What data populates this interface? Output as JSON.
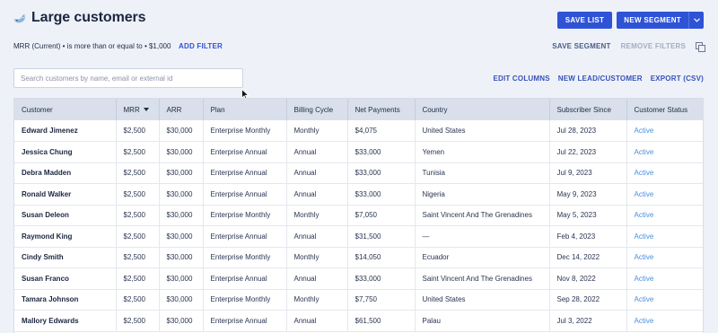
{
  "header": {
    "title": "Large customers",
    "save_list_label": "SAVE LIST",
    "new_segment_label": "NEW SEGMENT"
  },
  "filters": {
    "chip": "MRR (Current) • is more than or equal to • $1,000",
    "add_filter_label": "ADD FILTER",
    "save_segment_label": "SAVE SEGMENT",
    "remove_filters_label": "REMOVE FILTERS"
  },
  "search": {
    "placeholder": "Search customers by name, email or external id",
    "value": ""
  },
  "table_actions": {
    "edit_columns": "EDIT COLUMNS",
    "new_lead": "NEW LEAD/CUSTOMER",
    "export": "EXPORT (CSV)"
  },
  "table": {
    "columns": [
      "Customer",
      "MRR",
      "ARR",
      "Plan",
      "Billing Cycle",
      "Net Payments",
      "Country",
      "Subscriber Since",
      "Customer Status"
    ],
    "sorted_column": "MRR",
    "rows": [
      [
        "Edward Jimenez",
        "$2,500",
        "$30,000",
        "Enterprise Monthly",
        "Monthly",
        "$4,075",
        "United States",
        "Jul 28, 2023",
        "Active"
      ],
      [
        "Jessica Chung",
        "$2,500",
        "$30,000",
        "Enterprise Annual",
        "Annual",
        "$33,000",
        "Yemen",
        "Jul 22, 2023",
        "Active"
      ],
      [
        "Debra Madden",
        "$2,500",
        "$30,000",
        "Enterprise Annual",
        "Annual",
        "$33,000",
        "Tunisia",
        "Jul 9, 2023",
        "Active"
      ],
      [
        "Ronald Walker",
        "$2,500",
        "$30,000",
        "Enterprise Annual",
        "Annual",
        "$33,000",
        "Nigeria",
        "May 9, 2023",
        "Active"
      ],
      [
        "Susan Deleon",
        "$2,500",
        "$30,000",
        "Enterprise Monthly",
        "Monthly",
        "$7,050",
        "Saint Vincent And The Grenadines",
        "May 5, 2023",
        "Active"
      ],
      [
        "Raymond King",
        "$2,500",
        "$30,000",
        "Enterprise Annual",
        "Annual",
        "$31,500",
        "—",
        "Feb 4, 2023",
        "Active"
      ],
      [
        "Cindy Smith",
        "$2,500",
        "$30,000",
        "Enterprise Monthly",
        "Monthly",
        "$14,050",
        "Ecuador",
        "Dec 14, 2022",
        "Active"
      ],
      [
        "Susan Franco",
        "$2,500",
        "$30,000",
        "Enterprise Annual",
        "Annual",
        "$33,000",
        "Saint Vincent And The Grenadines",
        "Nov 8, 2022",
        "Active"
      ],
      [
        "Tamara Johnson",
        "$2,500",
        "$30,000",
        "Enterprise Monthly",
        "Monthly",
        "$7,750",
        "United States",
        "Sep 28, 2022",
        "Active"
      ],
      [
        "Mallory Edwards",
        "$2,500",
        "$30,000",
        "Enterprise Annual",
        "Annual",
        "$61,500",
        "Palau",
        "Jul 3, 2022",
        "Active"
      ]
    ]
  },
  "colors": {
    "accent": "#2f53d6",
    "status_active": "#4a8fe0",
    "background": "#eef1f8"
  },
  "icons": {
    "title_icon": "whale-icon",
    "dropdown_icon": "chevron-down-icon",
    "copy_icon": "copy-icon",
    "sort_icon": "sort-desc-icon",
    "cursor_icon": "mouse-pointer-icon"
  }
}
